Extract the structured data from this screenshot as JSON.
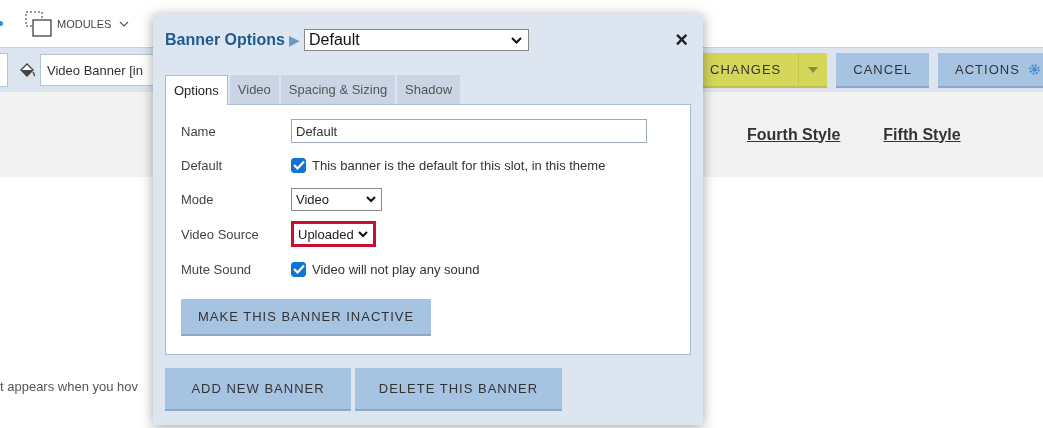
{
  "top_bar": {
    "modules_label": "MODULES"
  },
  "toolbar": {
    "banner_field": {
      "value": "Video Banner [in"
    },
    "buttons": [
      {
        "label": "CHANGES",
        "kind": "split"
      },
      {
        "label": "CANCEL",
        "kind": "plain"
      },
      {
        "label": "ACTIONS",
        "kind": "gear"
      }
    ]
  },
  "style_links": [
    "Fourth Style",
    "Fifth Style"
  ],
  "body_text": "t appears when you hov",
  "dialog": {
    "title": "Banner Options",
    "separator": "▶",
    "preset": {
      "value": "Default"
    },
    "close": "×",
    "tabs": [
      {
        "label": "Options",
        "selected": true
      },
      {
        "label": "Video",
        "selected": false
      },
      {
        "label": "Spacing & Sizing",
        "selected": false
      },
      {
        "label": "Shadow",
        "selected": false
      }
    ],
    "fields": [
      {
        "label": "Name",
        "kind": "text",
        "value": "Default"
      },
      {
        "label": "Default",
        "kind": "checkbox",
        "checked": true,
        "text": "This banner is the default for this slot, in this theme"
      },
      {
        "label": "Mode",
        "kind": "select",
        "value": "Video",
        "highlighted": false
      },
      {
        "label": "Video Source",
        "kind": "select",
        "value": "Uploaded",
        "highlighted": true
      },
      {
        "label": "Mute Sound",
        "kind": "checkbox",
        "checked": true,
        "text": "Video will not play any sound"
      }
    ],
    "inactive_button": "MAKE THIS BANNER INACTIVE",
    "footer_buttons": [
      "ADD NEW BANNER",
      "DELETE THIS BANNER"
    ]
  }
}
